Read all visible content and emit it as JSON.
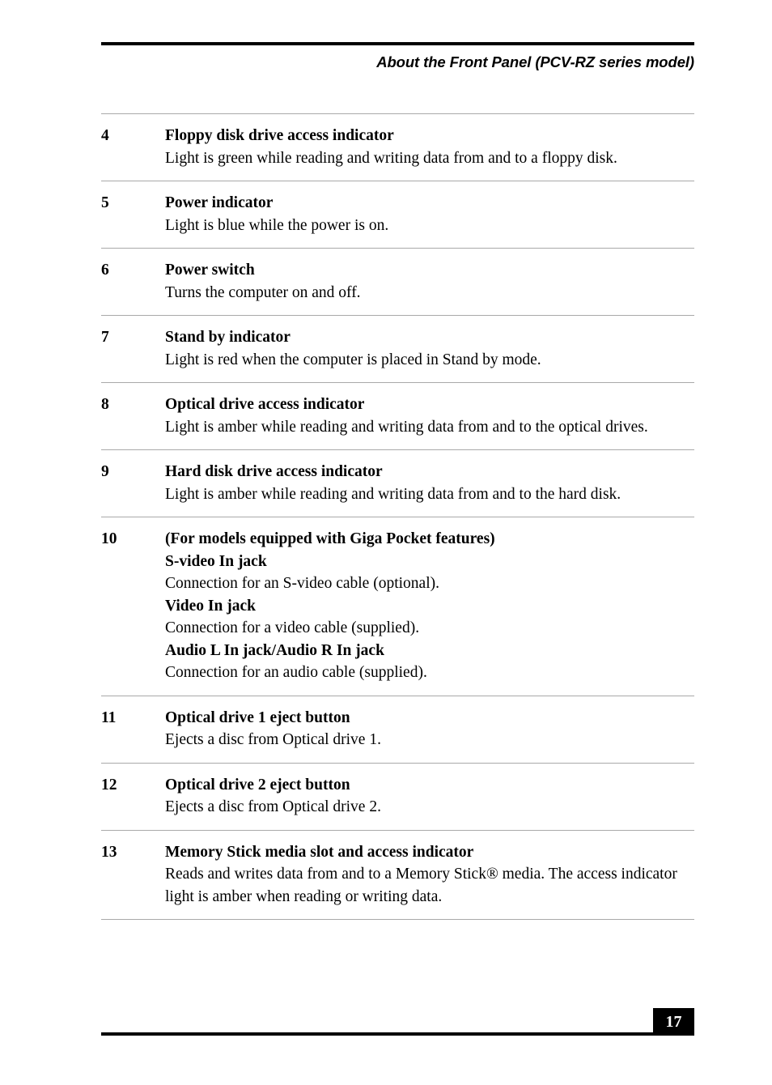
{
  "header": {
    "title": "About the Front Panel (PCV-RZ series model)"
  },
  "items": [
    {
      "number": "4",
      "lines": [
        {
          "style": "bold",
          "text": "Floppy disk drive access indicator"
        },
        {
          "style": "normal",
          "text": "Light is green while reading and writing data from and to a floppy disk."
        }
      ]
    },
    {
      "number": "5",
      "lines": [
        {
          "style": "bold",
          "text": "Power indicator"
        },
        {
          "style": "normal",
          "text": "Light is blue while the power is on."
        }
      ]
    },
    {
      "number": "6",
      "lines": [
        {
          "style": "bold",
          "text": "Power switch"
        },
        {
          "style": "normal",
          "text": "Turns the computer on and off."
        }
      ]
    },
    {
      "number": "7",
      "lines": [
        {
          "style": "bold",
          "text": "Stand by indicator"
        },
        {
          "style": "normal",
          "text": "Light is red when the computer is placed in Stand by mode."
        }
      ]
    },
    {
      "number": "8",
      "lines": [
        {
          "style": "bold",
          "text": "Optical drive access indicator"
        },
        {
          "style": "normal",
          "text": "Light is amber while reading and writing data from and to the optical drives."
        }
      ]
    },
    {
      "number": "9",
      "lines": [
        {
          "style": "bold",
          "text": "Hard disk drive access indicator"
        },
        {
          "style": "normal",
          "text": "Light is amber while reading and writing data from and to the hard disk."
        }
      ]
    },
    {
      "number": "10",
      "lines": [
        {
          "style": "bold",
          "text": "(For models equipped with Giga Pocket features)"
        },
        {
          "style": "bold",
          "text": "S-video In jack"
        },
        {
          "style": "normal",
          "text": "Connection for an S-video cable (optional)."
        },
        {
          "style": "bold",
          "text": "Video In jack"
        },
        {
          "style": "normal",
          "text": "Connection for a video cable (supplied)."
        },
        {
          "style": "bold",
          "text": "Audio L In jack/Audio R In jack"
        },
        {
          "style": "normal",
          "text": "Connection for an audio cable (supplied)."
        }
      ]
    },
    {
      "number": "11",
      "lines": [
        {
          "style": "bold",
          "text": "Optical drive 1 eject button"
        },
        {
          "style": "normal",
          "text": "Ejects a disc from Optical drive 1."
        }
      ]
    },
    {
      "number": "12",
      "lines": [
        {
          "style": "bold",
          "text": "Optical drive 2 eject button"
        },
        {
          "style": "normal",
          "text": "Ejects a disc from Optical drive 2."
        }
      ]
    },
    {
      "number": "13",
      "lines": [
        {
          "style": "bold",
          "text": "Memory Stick media slot and access indicator"
        },
        {
          "style": "normal",
          "text": "Reads and writes data from and to a Memory Stick® media. The access indicator light is amber when reading or writing data."
        }
      ]
    }
  ],
  "footer": {
    "page_number": "17"
  }
}
